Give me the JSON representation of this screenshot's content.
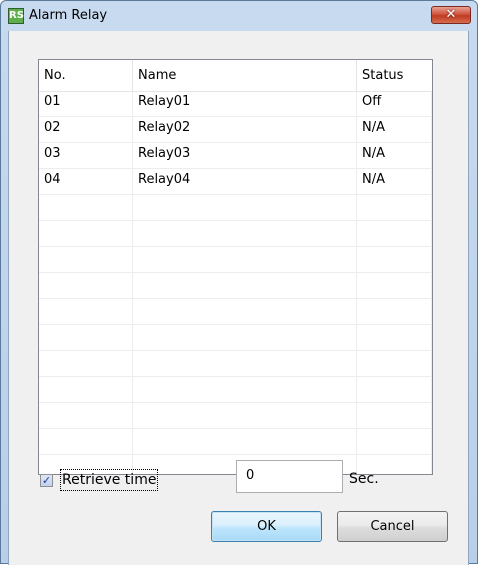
{
  "window": {
    "title": "Alarm Relay",
    "icon_name": "rs-app-icon",
    "icon_text": "RS",
    "close_label": "✕"
  },
  "list": {
    "columns": [
      "No.",
      "Name",
      "Status"
    ],
    "rows": [
      {
        "no": "01",
        "name": "Relay01",
        "status": "Off"
      },
      {
        "no": "02",
        "name": "Relay02",
        "status": "N/A"
      },
      {
        "no": "03",
        "name": "Relay03",
        "status": "N/A"
      },
      {
        "no": "04",
        "name": "Relay04",
        "status": "N/A"
      }
    ]
  },
  "retrieve": {
    "checked": true,
    "label": "Retrieve time",
    "value": "0",
    "unit": "Sec."
  },
  "buttons": {
    "ok": "OK",
    "cancel": "Cancel"
  },
  "colors": {
    "titlebar": "#c8daef",
    "close_button": "#c03b22",
    "default_button_border": "#3c7fb1",
    "dialog_background": "#f0f0f0"
  }
}
